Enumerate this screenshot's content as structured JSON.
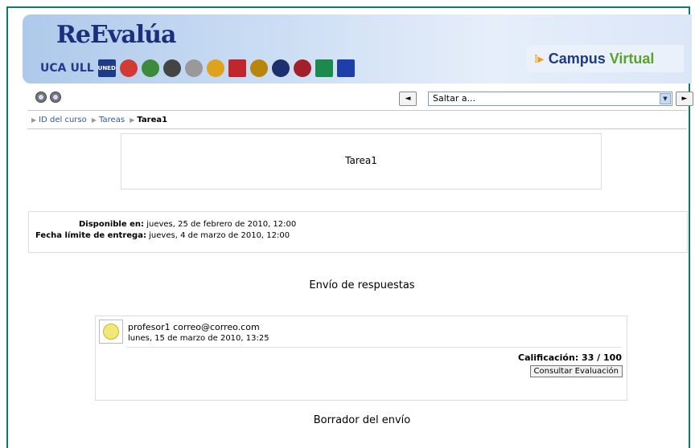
{
  "header": {
    "logo": "ReEvalúa",
    "institutions": [
      "UCA",
      "ULL",
      "UNED"
    ],
    "campus": {
      "part1": "Campus",
      "part2": "Virtual"
    }
  },
  "toolbar": {
    "prev_label": "◄",
    "jump_placeholder": "Saltar a...",
    "next_label": "►"
  },
  "breadcrumb": {
    "items": [
      "ID del curso",
      "Tareas",
      "Tarea1"
    ]
  },
  "task": {
    "title": "Tarea1",
    "available_label": "Disponible en:",
    "available_value": "jueves, 25 de febrero de 2010, 12:00",
    "due_label": "Fecha límite de entrega:",
    "due_value": "jueves, 4 de marzo de 2010, 12:00"
  },
  "submission": {
    "heading": "Envío de respuestas",
    "user": "profesor1 correo@correo.com",
    "date": "lunes, 15 de marzo de 2010, 13:25",
    "grade": "Calificación: 33 / 100",
    "consult_button": "Consultar Evaluación"
  },
  "draft": {
    "heading": "Borrador del envío"
  },
  "colors": {
    "frame": "#0d7a6e",
    "brand_blue": "#1b3a8c",
    "brand_green": "#5aa329"
  }
}
